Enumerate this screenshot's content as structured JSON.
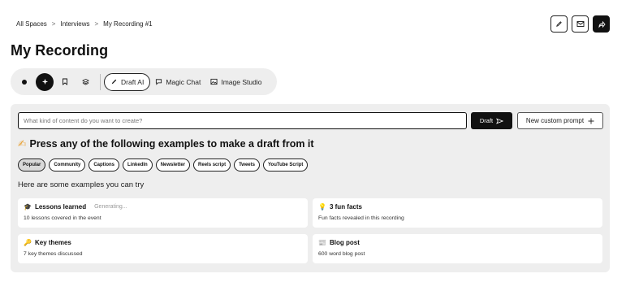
{
  "breadcrumb": [
    "All Spaces",
    "Interviews",
    "My Recording #1"
  ],
  "breadcrumb_sep": ">",
  "top_actions": [
    {
      "icon": "pencil-icon"
    },
    {
      "icon": "mail-icon"
    },
    {
      "icon": "share-icon"
    }
  ],
  "page_title": "My Recording",
  "toolbar": {
    "draft_ai": "Draft AI",
    "magic_chat": "Magic Chat",
    "image_studio": "Image Studio"
  },
  "prompt": {
    "placeholder": "What kind of content do you want to create?",
    "draft_button": "Draft",
    "custom_button": "New custom prompt"
  },
  "heading": {
    "emoji": "✍",
    "text": "Press any of the following examples to make a draft from it"
  },
  "chips": [
    "Popular",
    "Community",
    "Captions",
    "LinkedIn",
    "Newsletter",
    "Reels script",
    "Tweets",
    "YouTube Script"
  ],
  "selected_chip": "Popular",
  "examples_label": "Here are some examples you can try",
  "cards": [
    {
      "emoji": "🎓",
      "title": "Lessons learned",
      "status": "Generating...",
      "desc": "10 lessons covered in the event"
    },
    {
      "emoji": "💡",
      "title": "3 fun facts",
      "status": "",
      "desc": "Fun facts revealed in this recording"
    },
    {
      "emoji": "🔑",
      "title": "Key themes",
      "status": "",
      "desc": "7 key themes discussed"
    },
    {
      "emoji": "📰",
      "title": "Blog post",
      "status": "",
      "desc": "600 word blog post"
    }
  ],
  "colors": {
    "accent": "#111111",
    "panel": "#eeeeee",
    "selected_chip": "#d9d9d9"
  }
}
